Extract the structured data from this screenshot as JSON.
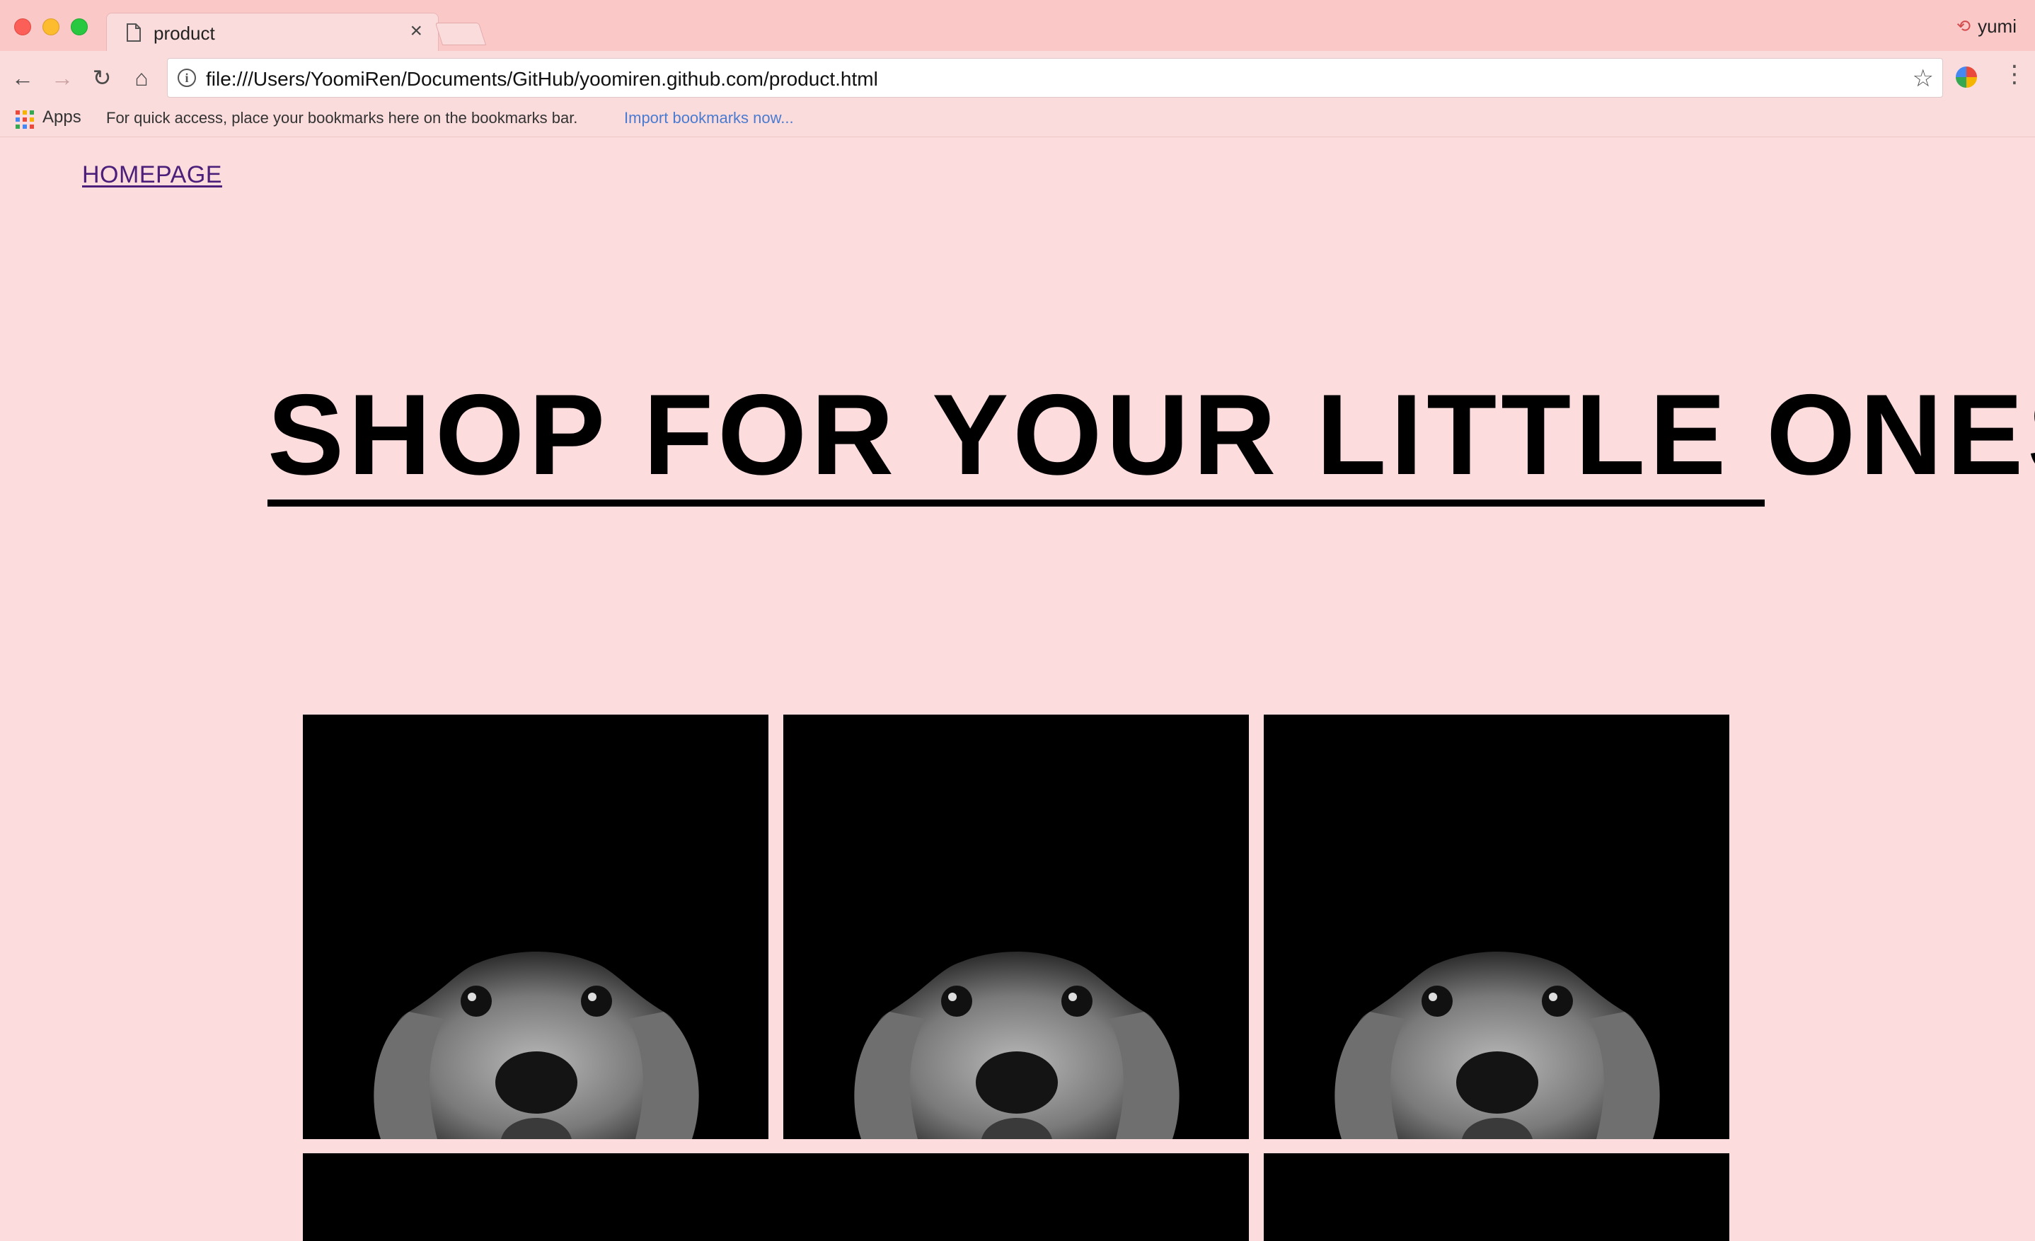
{
  "browser": {
    "tab_title": "product",
    "tab_close": "×",
    "profile_name": "yumi",
    "url": "file:///Users/YoomiRen/Documents/GitHub/yoomiren.github.com/product.html",
    "bookmarks_bar": {
      "apps_label": "Apps",
      "hint": "For quick access, place your bookmarks here on the bookmarks bar.",
      "import_link": "Import bookmarks now..."
    },
    "nav": {
      "back": "←",
      "forward": "→",
      "reload": "↻",
      "home": "⌂",
      "star": "☆",
      "menu": "⋮",
      "info": "i"
    }
  },
  "page": {
    "nav_link": "HOMEPAGE",
    "headline": "SHOP FOR YOUR LITTLE ONES,",
    "product_tiles": [
      {
        "image": "dachshund-photo"
      },
      {
        "image": "dachshund-photo"
      },
      {
        "image": "dachshund-photo"
      },
      {
        "image": "black-tile"
      },
      {
        "image": "black-tile"
      }
    ]
  },
  "colors": {
    "page_background": "#fcdcdc",
    "chrome_background": "#fbc8c8",
    "link_visited": "#4b1f7a",
    "import_link": "#4a7bd0"
  }
}
